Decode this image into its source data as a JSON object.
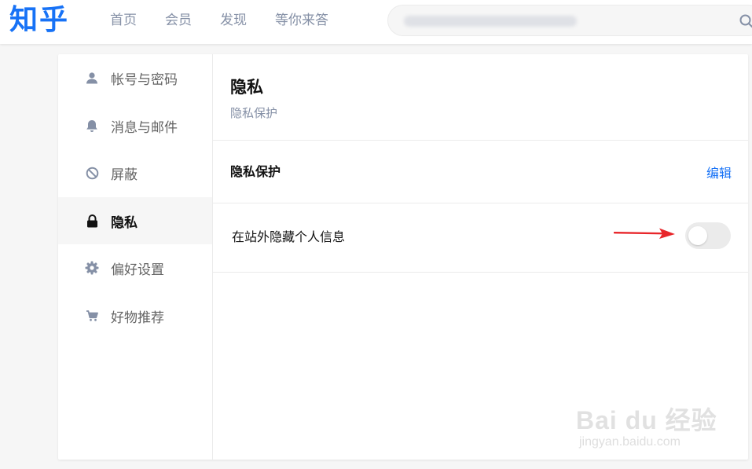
{
  "header": {
    "logo": "知乎",
    "nav": [
      "首页",
      "会员",
      "发现",
      "等你来答"
    ],
    "search_icon": "search-icon"
  },
  "sidebar": {
    "items": [
      {
        "label": "帐号与密码",
        "icon": "user-icon",
        "active": false
      },
      {
        "label": "消息与邮件",
        "icon": "bell-icon",
        "active": false
      },
      {
        "label": "屏蔽",
        "icon": "block-icon",
        "active": false
      },
      {
        "label": "隐私",
        "icon": "lock-icon",
        "active": true
      },
      {
        "label": "偏好设置",
        "icon": "gear-icon",
        "active": false
      },
      {
        "label": "好物推荐",
        "icon": "cart-icon",
        "active": false
      }
    ]
  },
  "content": {
    "title": "隐私",
    "subtitle": "隐私保护",
    "section": {
      "title": "隐私保护",
      "edit_label": "编辑",
      "settings": [
        {
          "label": "在站外隐藏个人信息",
          "enabled": false
        }
      ]
    }
  },
  "watermark": {
    "text": "Bai du 经验",
    "url": "jingyan.baidu.com"
  },
  "colors": {
    "brand": "#1772f6",
    "annotation_arrow": "#e8262a"
  }
}
